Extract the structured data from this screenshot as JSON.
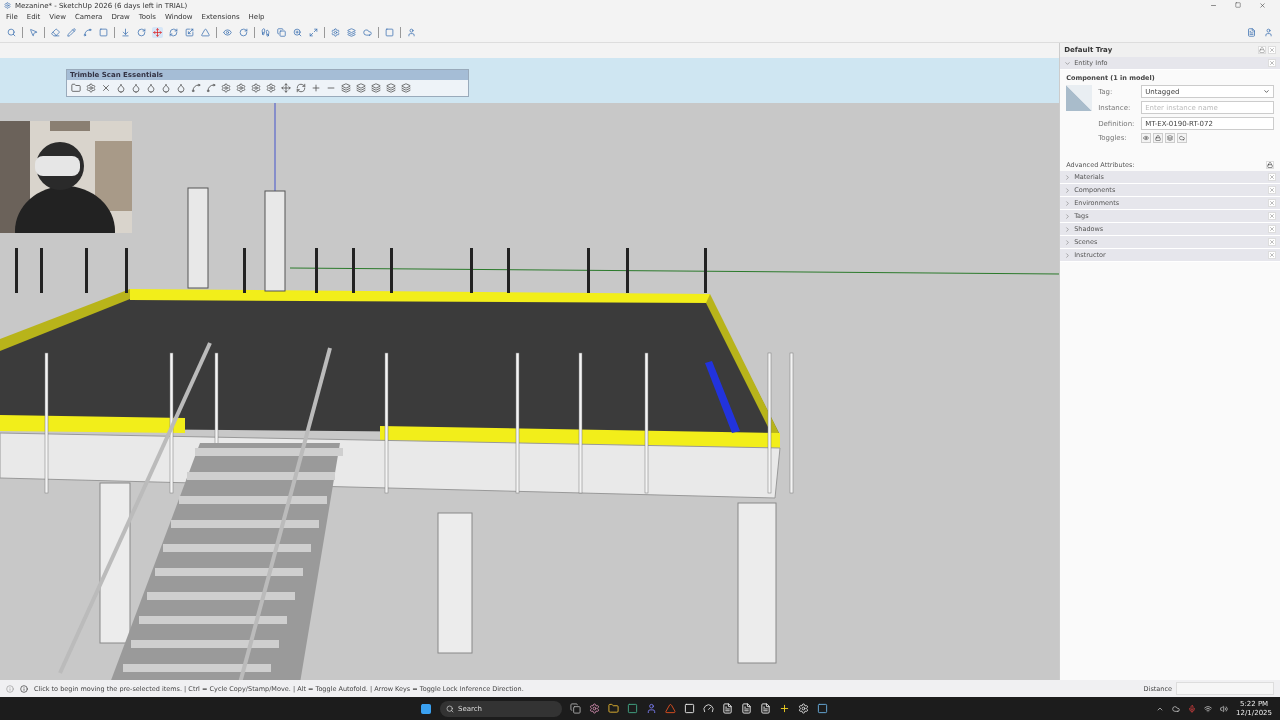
{
  "window": {
    "title": "Mezanine* - SketchUp 2026 (6 days left in TRIAL)"
  },
  "menu": [
    "File",
    "Edit",
    "View",
    "Camera",
    "Draw",
    "Tools",
    "Window",
    "Extensions",
    "Help"
  ],
  "scan_toolbar": {
    "title": "Trimble Scan Essentials"
  },
  "tray": {
    "title": "Default Tray",
    "entity_info": {
      "title": "Entity Info",
      "expanded": true,
      "heading": "Component (1 in model)",
      "fields": [
        {
          "kind": "select",
          "label": "Tag:",
          "value": "Untagged"
        },
        {
          "kind": "input",
          "label": "Instance:",
          "placeholder": "Enter instance name"
        },
        {
          "kind": "input",
          "label": "Definition:",
          "value": "MT-EX-0190-RT-072"
        },
        {
          "kind": "toggles",
          "label": "Toggles:"
        }
      ],
      "advanced": "Advanced Attributes:"
    },
    "panels": [
      {
        "title": "Materials",
        "expanded": false
      },
      {
        "title": "Components",
        "expanded": false
      },
      {
        "title": "Environments",
        "expanded": false
      },
      {
        "title": "Tags",
        "expanded": false
      },
      {
        "title": "Shadows",
        "expanded": false
      },
      {
        "title": "Scenes",
        "expanded": false
      },
      {
        "title": "Instructor",
        "expanded": false
      }
    ]
  },
  "status_bar": {
    "message": "Click to begin moving the pre-selected items. | Ctrl = Cycle Copy/Stamp/Move. | Alt = Toggle Autofold. | Arrow Keys = Toggle Lock Inference Direction.",
    "measure_label": "Distance"
  },
  "taskbar": {
    "search_placeholder": "Search",
    "time": "5:22 PM",
    "date": "12/1/2025"
  }
}
